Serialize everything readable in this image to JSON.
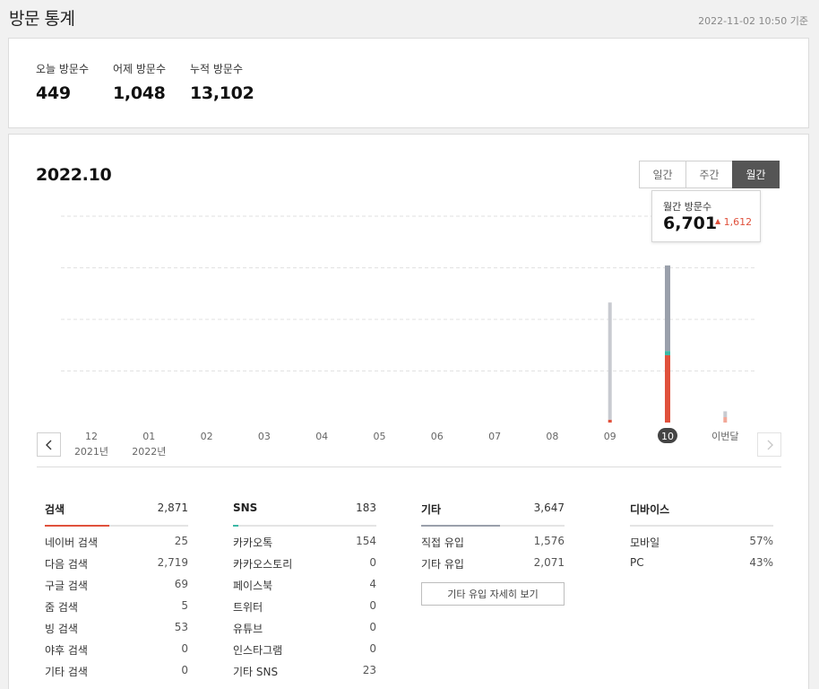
{
  "header": {
    "title": "방문 통계",
    "timestamp": "2022-11-02 10:50 기준"
  },
  "summary": [
    {
      "label": "오늘 방문수",
      "value": "449"
    },
    {
      "label": "어제 방문수",
      "value": "1,048"
    },
    {
      "label": "누적 방문수",
      "value": "13,102"
    }
  ],
  "main": {
    "period": "2022.10",
    "tabs": [
      "일간",
      "주간",
      "월간"
    ],
    "active_tab": "월간"
  },
  "tooltip": {
    "label": "월간 방문수",
    "value": "6,701",
    "change": "1,612",
    "change_color": "#e0513c"
  },
  "colors": {
    "search": "#e0513c",
    "sns": "#3cb8a6",
    "etc": "#9aa0ab",
    "etc_light": "#c8cad0",
    "current_month_light": "#f2a898",
    "active_axis": "#444444"
  },
  "chart_data": {
    "type": "bar",
    "categories": [
      "12",
      "01",
      "02",
      "03",
      "04",
      "05",
      "06",
      "07",
      "08",
      "09",
      "10",
      "이번달"
    ],
    "year_labels": [
      "2021년",
      "2022년",
      "",
      "",
      "",
      "",
      "",
      "",
      "",
      "",
      "",
      ""
    ],
    "series": [
      {
        "key": "search",
        "values": [
          0,
          0,
          0,
          0,
          0,
          0,
          0,
          0,
          0,
          120,
          2871,
          230
        ]
      },
      {
        "key": "sns",
        "values": [
          0,
          0,
          0,
          0,
          0,
          0,
          0,
          0,
          0,
          0,
          183,
          0
        ]
      },
      {
        "key": "etc",
        "values": [
          0,
          0,
          0,
          0,
          0,
          0,
          0,
          0,
          0,
          5000,
          3647,
          250
        ]
      }
    ],
    "highlighted": "10",
    "ylim": [
      0,
      8800
    ],
    "grid": true
  },
  "breakdown": [
    {
      "label": "검색",
      "total": "2,871",
      "bar_color": "#e0513c",
      "ratio": 0.45,
      "rows": [
        {
          "name": "네이버 검색",
          "value": "25"
        },
        {
          "name": "다음 검색",
          "value": "2,719"
        },
        {
          "name": "구글 검색",
          "value": "69"
        },
        {
          "name": "줌 검색",
          "value": "5"
        },
        {
          "name": "빙 검색",
          "value": "53"
        },
        {
          "name": "야후 검색",
          "value": "0"
        },
        {
          "name": "기타 검색",
          "value": "0"
        }
      ]
    },
    {
      "label": "SNS",
      "total": "183",
      "bar_color": "#3cb8a6",
      "ratio": 0.04,
      "rows": [
        {
          "name": "카카오톡",
          "value": "154"
        },
        {
          "name": "카카오스토리",
          "value": "0"
        },
        {
          "name": "페이스북",
          "value": "4"
        },
        {
          "name": "트위터",
          "value": "0"
        },
        {
          "name": "유튜브",
          "value": "0"
        },
        {
          "name": "인스타그램",
          "value": "0"
        },
        {
          "name": "기타 SNS",
          "value": "23"
        }
      ]
    },
    {
      "label": "기타",
      "total": "3,647",
      "bar_color": "#9aa0ab",
      "ratio": 0.55,
      "rows": [
        {
          "name": "직접 유입",
          "value": "1,576"
        },
        {
          "name": "기타 유입",
          "value": "2,071"
        }
      ],
      "button_label": "기타 유입 자세히 보기"
    },
    {
      "label": "디바이스",
      "total": "",
      "bar_color": "#9aa0ab",
      "ratio": 0,
      "rows": [
        {
          "name": "모바일",
          "value": "57%"
        },
        {
          "name": "PC",
          "value": "43%"
        }
      ]
    }
  ]
}
